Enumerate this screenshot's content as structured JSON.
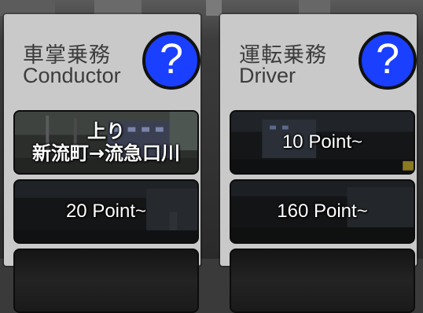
{
  "colors": {
    "panel": "#c9c9c9",
    "help_button": "#1a3fff",
    "title_text": "#3c3c3c",
    "button_text": "#ffffff"
  },
  "conductor": {
    "title_ja": "車掌乗務",
    "title_en": "Conductor",
    "help_icon": "question-mark-icon",
    "help_label": "?",
    "buttons": [
      {
        "line1": "上り",
        "line2": "新流町→流急口川"
      },
      {
        "line1": "20 Point~"
      }
    ]
  },
  "driver": {
    "title_ja": "運転乗務",
    "title_en": "Driver",
    "help_icon": "question-mark-icon",
    "help_label": "?",
    "buttons": [
      {
        "line1": "10 Point~"
      },
      {
        "line1": "160 Point~"
      }
    ]
  }
}
